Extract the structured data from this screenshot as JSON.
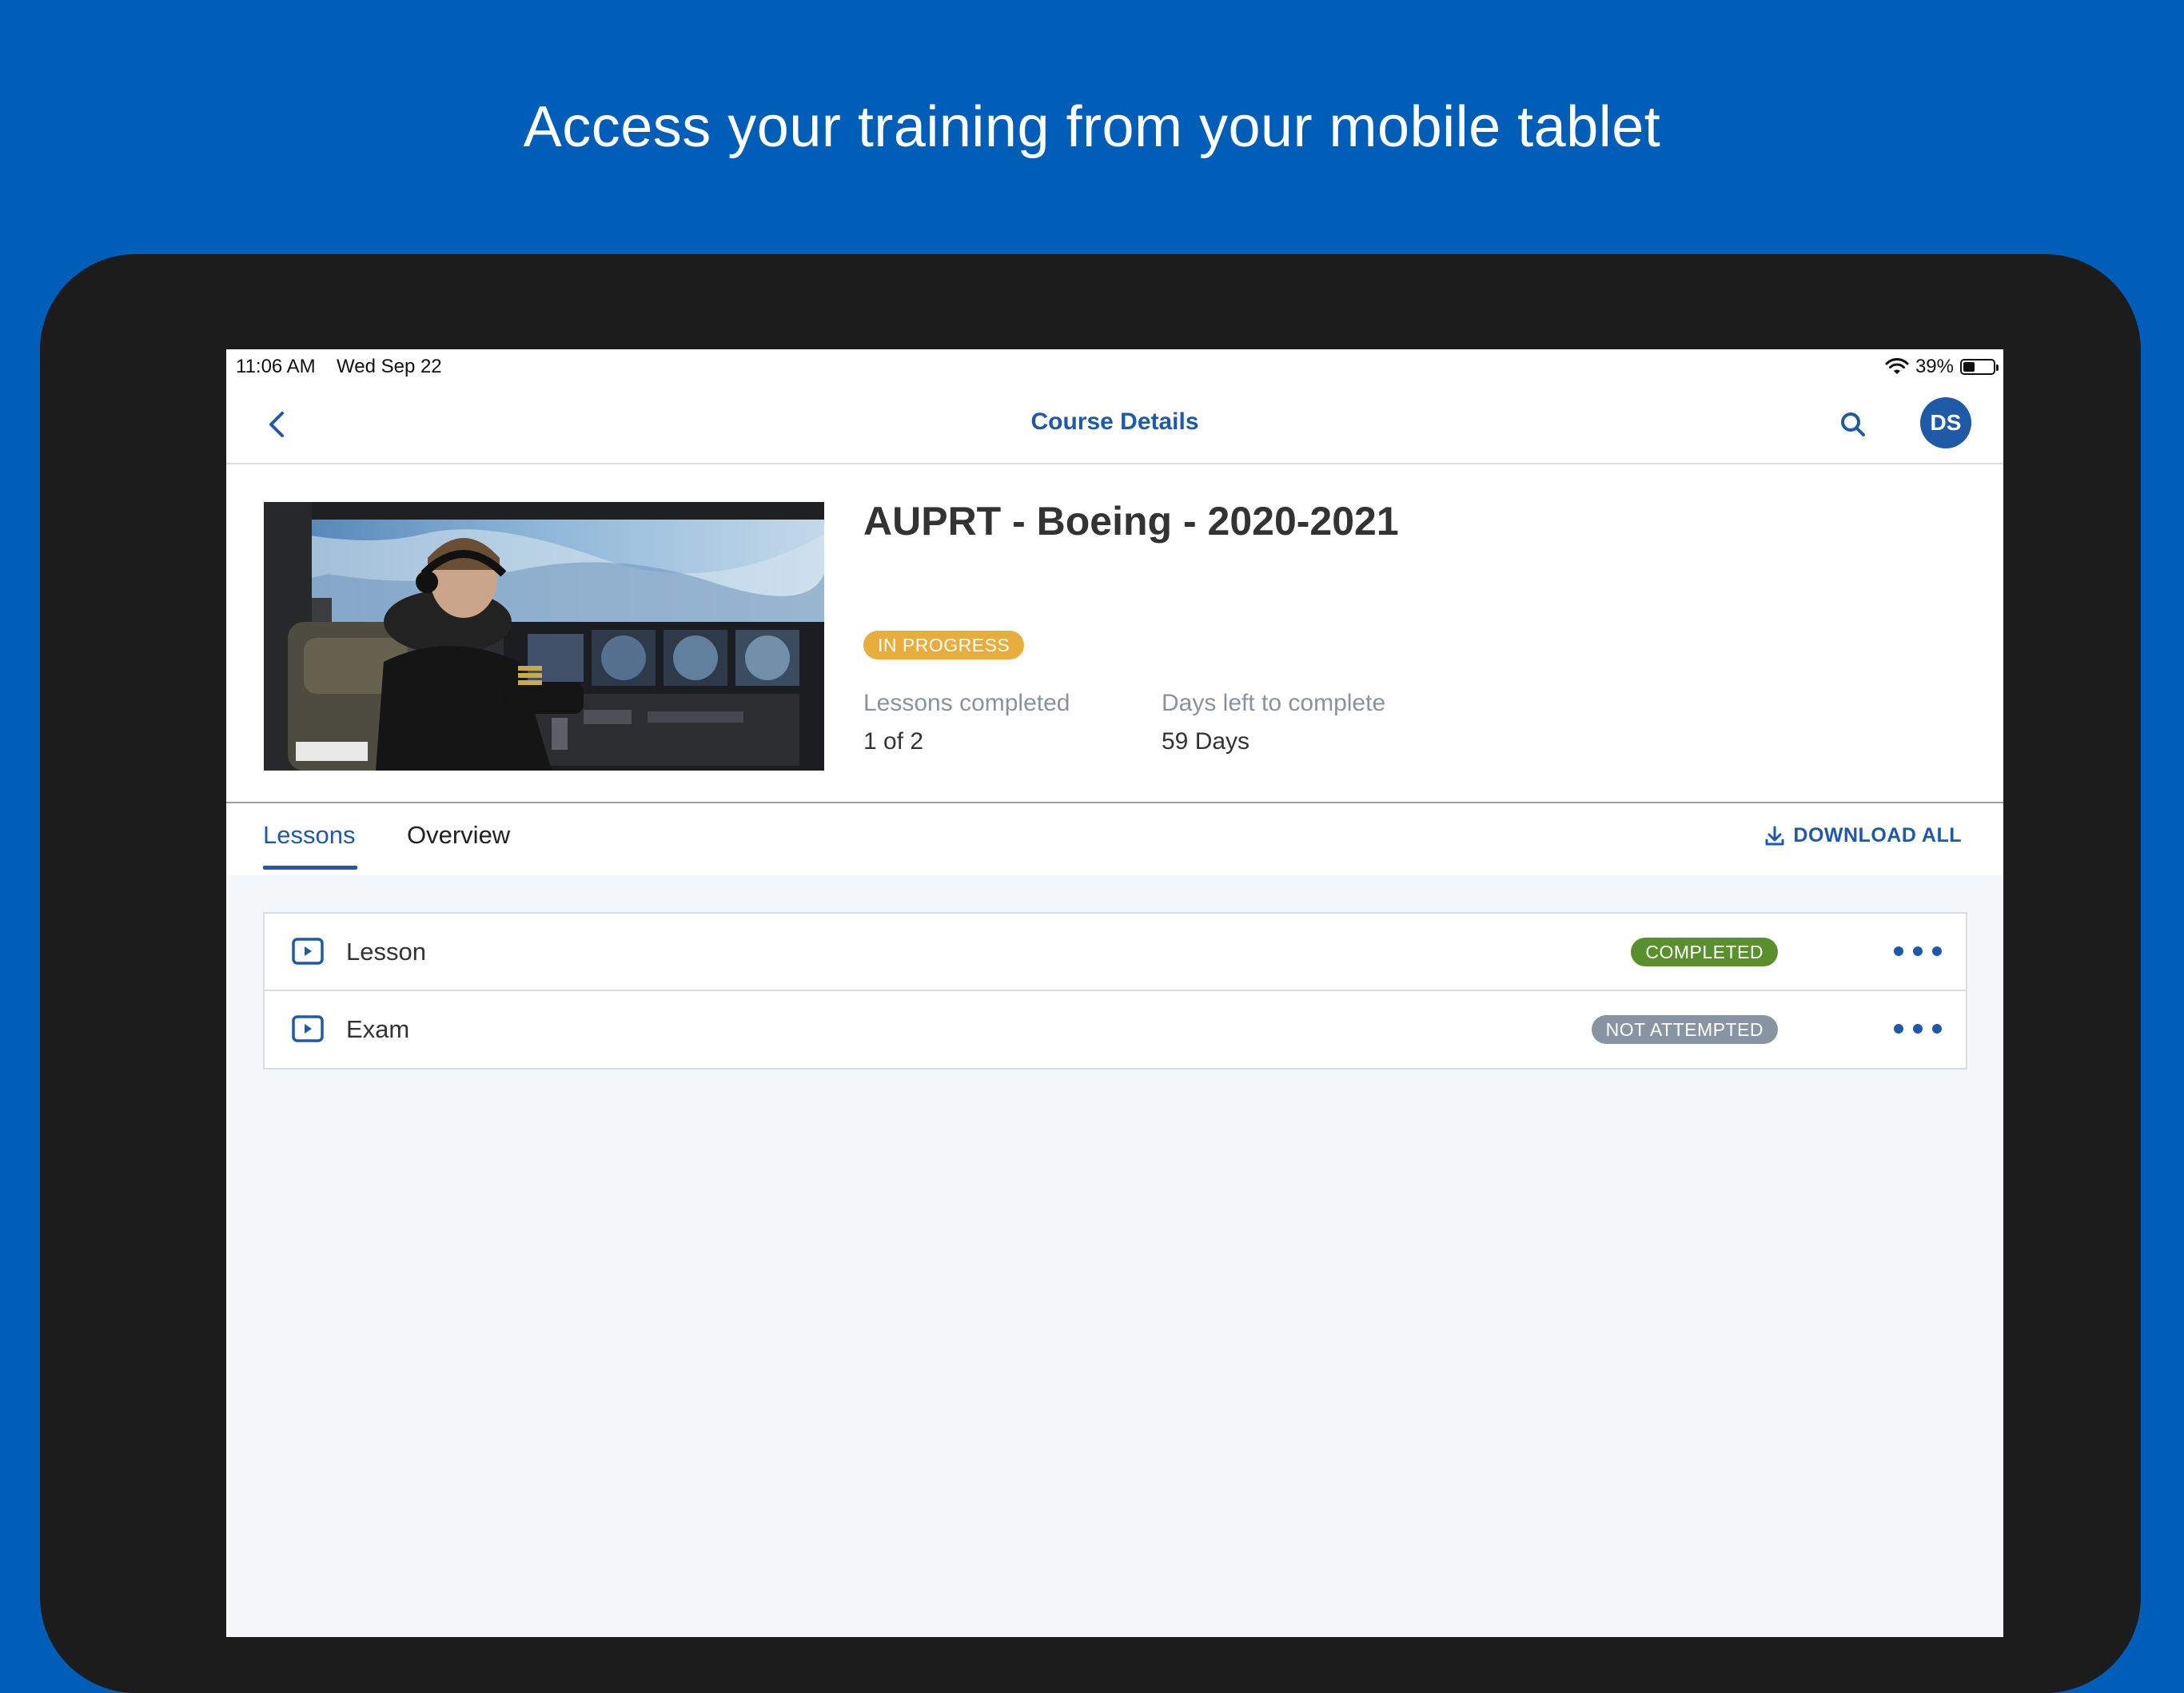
{
  "headline": "Access your training from your mobile tablet",
  "status_bar": {
    "time": "11:06 AM",
    "date": "Wed Sep 22",
    "battery_percent": "39%",
    "battery_level": 0.39
  },
  "nav": {
    "title": "Course Details",
    "avatar_initials": "DS"
  },
  "course": {
    "title": "AUPRT - Boeing - 2020-2021",
    "status": "IN PROGRESS",
    "lessons_completed_label": "Lessons completed",
    "lessons_completed_value": "1 of 2",
    "days_left_label": "Days left to complete",
    "days_left_value": "59 Days"
  },
  "tabs": [
    {
      "label": "Lessons",
      "active": true
    },
    {
      "label": "Overview",
      "active": false
    }
  ],
  "download_all_label": "DOWNLOAD ALL",
  "lessons": [
    {
      "name": "Lesson",
      "status": "COMPLETED",
      "status_color": "#5a8f2e"
    },
    {
      "name": "Exam",
      "status": "NOT ATTEMPTED",
      "status_color": "#8795a3"
    }
  ],
  "colors": {
    "brand_blue": "#005EB8",
    "accent": "#1f5aa9",
    "in_progress": "#e9ad3e"
  }
}
